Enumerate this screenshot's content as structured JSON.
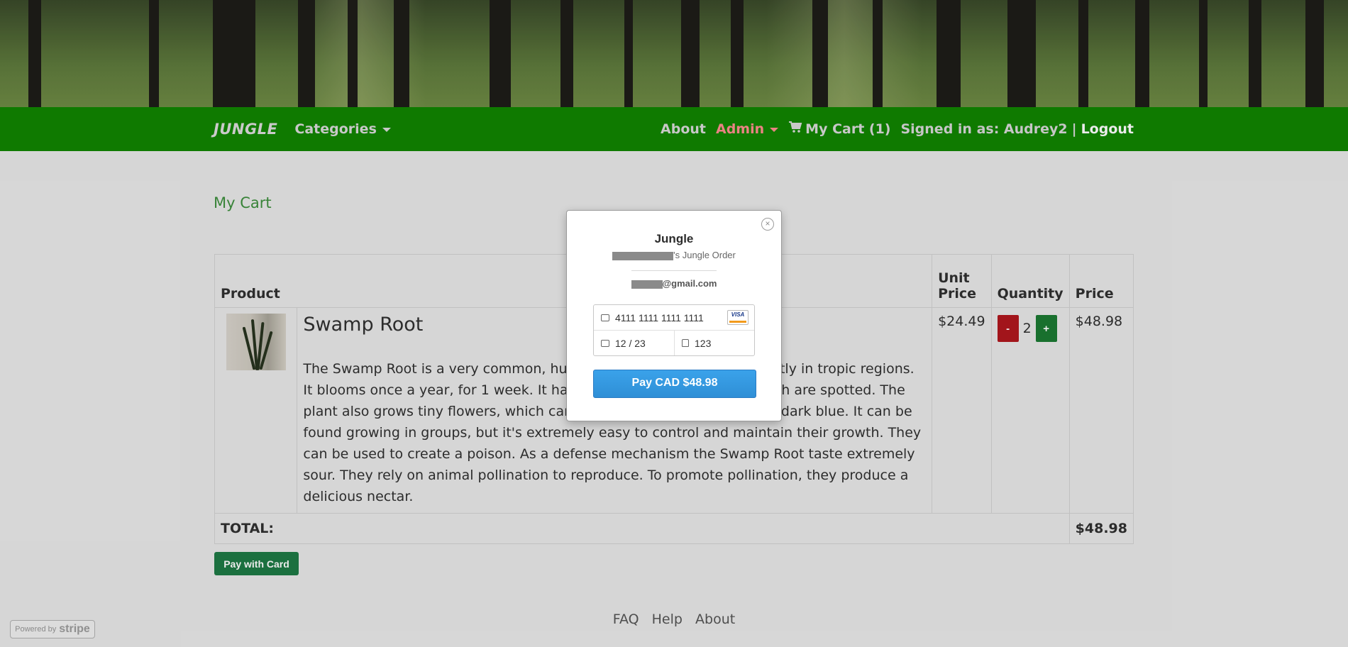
{
  "nav": {
    "brand": "JUNGLE",
    "categories": "Categories",
    "about": "About",
    "admin": "Admin",
    "cart": "My Cart (1)",
    "signed_in": "Signed in as: Audrey2",
    "separator": "|",
    "logout": "Logout"
  },
  "page": {
    "title": "My Cart"
  },
  "table": {
    "headers": {
      "product": "Product",
      "unit_price": "Unit Price",
      "quantity": "Quantity",
      "price": "Price"
    },
    "item": {
      "name": "Swamp Root",
      "description": "The Swamp Root is a very common, huge plant that can be found mostly in tropic regions. It blooms once a year, for 1 week. It has wide, egg shaped leaves which are spotted. The plant also grows tiny flowers, which can be dark pink, light purple and dark blue. It can be found growing in groups, but it's extremely easy to control and maintain their growth. They can be used to create a poison. As a defense mechanism the Swamp Root taste extremely sour. They rely on animal pollination to reproduce. To promote pollination, they produce a delicious nectar.",
      "unit_price": "$24.49",
      "quantity": "2",
      "minus": "-",
      "plus": "+",
      "price": "$48.98"
    },
    "total_label": "TOTAL:",
    "total_value": "$48.98"
  },
  "pay_with_card": "Pay with Card",
  "footer": {
    "faq": "FAQ",
    "help": "Help",
    "about": "About"
  },
  "stripe_badge": {
    "powered": "Powered by",
    "brand": "stripe"
  },
  "modal": {
    "title": "Jungle",
    "subtitle_suffix": "'s Jungle Order",
    "email_suffix": "@gmail.com",
    "card_number": "4111 1111 1111 1111",
    "card_brand": "VISA",
    "expiry": "12 / 23",
    "cvc": "123",
    "pay_button": "Pay CAD $48.98",
    "close": "×"
  },
  "colors": {
    "navbar": "#118500",
    "admin": "#ff8f8f",
    "pay_button": "#2f8fd6",
    "pay_with_card": "#1e7a45"
  }
}
